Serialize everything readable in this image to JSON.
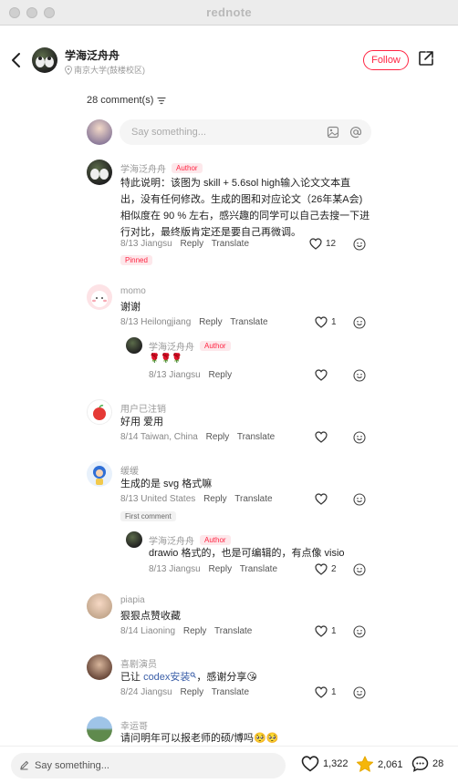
{
  "window": {
    "title": "rednote"
  },
  "header": {
    "author_name": "学海泛舟舟",
    "location": "南京大学(鼓楼校区)",
    "follow_label": "Follow"
  },
  "comments_header": {
    "count_label": "28 comment(s)"
  },
  "top_input": {
    "placeholder": "Say something..."
  },
  "comments": [
    {
      "name": "学海泛舟舟",
      "tag": "Author",
      "text_lines": [
        "特此说明：该图为 skill + 5.6sol high输入论文文本直",
        "出，没有任何修改。生成的图和对应论文（26年某A会)",
        "相似度在 90 % 左右，感兴趣的同学可以自己去搜一下进",
        "行对比，最终版肯定还是要自己再微调。"
      ],
      "date_loc": "8/13 Jiangsu",
      "reply": "Reply",
      "translate": "Translate",
      "likes": "12",
      "badge": "Pinned"
    },
    {
      "name": "momo",
      "text": "谢谢",
      "date_loc": "8/13 Heilongjiang",
      "reply": "Reply",
      "translate": "Translate",
      "likes": "1",
      "replies": [
        {
          "name": "学海泛舟舟",
          "tag": "Author",
          "text": "🌹🌹🌹",
          "date_loc": "8/13 Jiangsu",
          "reply": "Reply"
        }
      ]
    },
    {
      "name": "用户已注销",
      "text": "好用 爱用",
      "date_loc": "8/14 Taiwan, China",
      "reply": "Reply",
      "translate": "Translate"
    },
    {
      "name": "缓缓",
      "text": "生成的是 svg 格式嘛",
      "date_loc": "8/13 United States",
      "reply": "Reply",
      "translate": "Translate",
      "badge": "First comment",
      "replies": [
        {
          "name": "学海泛舟舟",
          "tag": "Author",
          "text": "drawio 格式的，也是可编辑的，有点像 visio",
          "date_loc": "8/13 Jiangsu",
          "reply": "Reply",
          "translate": "Translate",
          "likes": "2"
        }
      ]
    },
    {
      "name": "piapia",
      "text": "狠狠点赞收藏",
      "date_loc": "8/14 Liaoning",
      "reply": "Reply",
      "translate": "Translate",
      "likes": "1"
    },
    {
      "name": "喜剧演员",
      "text_pre": "已让 ",
      "text_link": "codex安装",
      "text_post": "，感谢分享😘",
      "date_loc": "8/24 Jiangsu",
      "reply": "Reply",
      "translate": "Translate",
      "likes": "1"
    },
    {
      "name": "幸运哥",
      "text": "请问明年可以报老师的硕/博吗🥺🥺"
    }
  ],
  "bottom_bar": {
    "placeholder": "Say something...",
    "likes": "1,322",
    "collects": "2,061",
    "comments": "28"
  },
  "colors": {
    "accent": "#ff2442",
    "link": "#3b5fa8",
    "star": "#f5b60a"
  }
}
